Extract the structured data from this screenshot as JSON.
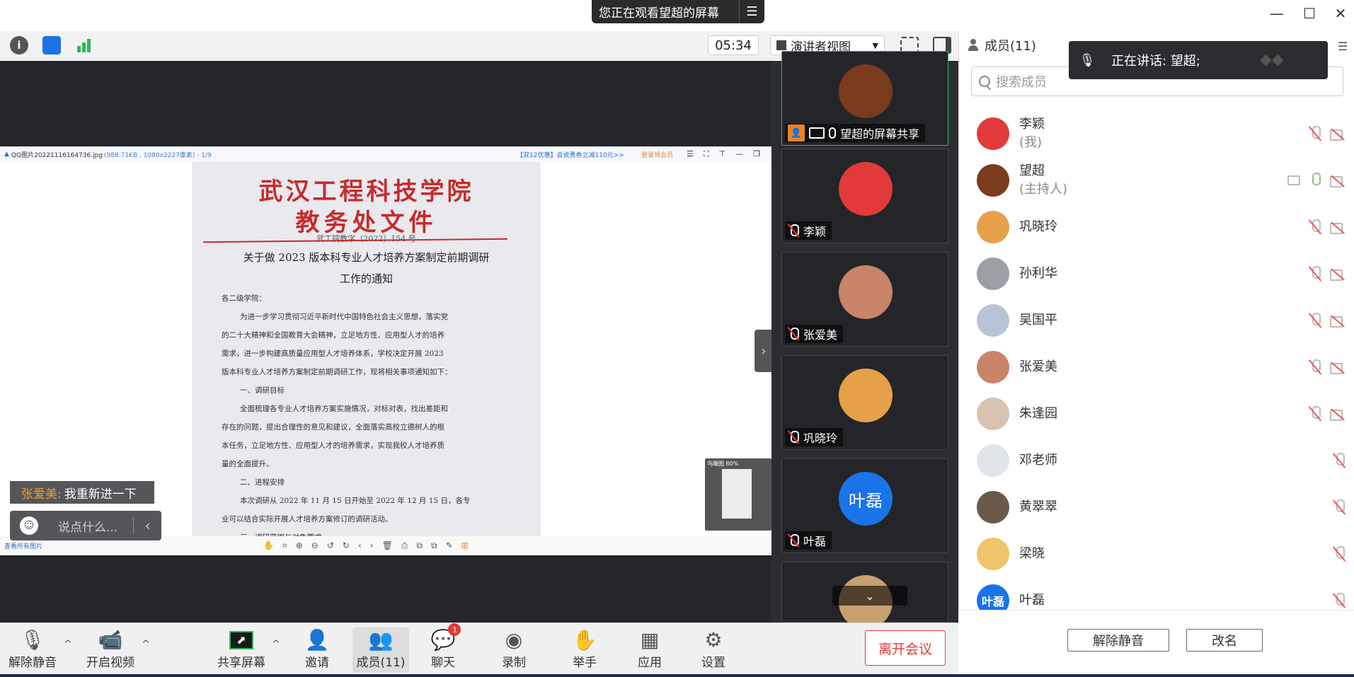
{
  "titlebar": {
    "watching_notice": "您正在观看望超的屏幕",
    "menu_glyph": "☰",
    "minimize": "—",
    "maximize": "☐",
    "close": "✕"
  },
  "toolbar": {
    "info_glyph": "i",
    "timer": "05:34",
    "view_mode": "演讲者视图",
    "view_caret": "▼"
  },
  "shared_window": {
    "filename": "QQ图片20221116164736.jpg",
    "meta": "(988.71KB , 1080x2227像素) - 1/9",
    "ad_text": "【双12优惠】会说勇券立减110元>>",
    "login_text": "登录领会员",
    "window_controls": [
      "☰",
      "⛶",
      "⊤",
      "—",
      "❐",
      "✕"
    ],
    "bottom_link": "查看所有图片",
    "mini_preview_label": "鸟瞰图 80%",
    "document": {
      "header_line1": "武汉工程科技学院",
      "header_line2": "教务处文件",
      "doc_number": "武工院教字〔2022〕154 号",
      "title_line1": "关于做 2023 版本科专业人才培养方案制定前期调研",
      "title_line2": "工作的通知",
      "paragraphs": [
        "各二级学院：",
        "为进一步学习贯彻习近平新时代中国特色社会主义思想，落实党",
        "的二十大精神和全国教育大会精神，立足地方性、应用型人才的培养",
        "需求，进一步构建高质量应用型人才培养体系，学校决定开展 2023",
        "版本科专业人才培养方案制定前期调研工作，现将相关事项通知如下：",
        "一、调研目标",
        "全面梳理各专业人才培养方案实施情况，对标对表，找出差距和",
        "存在的问题，提出合理性的意见和建议，全面落实高校立德树人的根",
        "本任务，立足地方性、应用型人才的培养需求，实现我校人才培养质",
        "量的全面提升。",
        "二、进程安排",
        "本次调研从 2022 年 11 月 15 日开始至 2022 年 12 月 15 日，各专",
        "业可以结合实际开展人才培养方案修订的调研活动。",
        "三、调研范围与对象要求"
      ]
    },
    "bottom_tools": [
      "✋",
      "⌗",
      "⊕",
      "⊖",
      "↺",
      "↻",
      "‹",
      "›",
      "🗑",
      "⎙",
      "⧉",
      "⧉",
      "✎",
      "⊞"
    ]
  },
  "collapse_glyph": "›",
  "chat": {
    "sender": "张爱美:",
    "message": "我重新进一下",
    "input_placeholder": "说点什么...",
    "emoji_glyph": "☺",
    "arrow_glyph": "‹"
  },
  "video_tiles": [
    {
      "name": "望超的屏幕共享",
      "color": "#7a3b1e",
      "host_glyph": "👤"
    },
    {
      "name": "李颖",
      "color": "#e23a3a"
    },
    {
      "name": "张爱美",
      "color": "#c9846a"
    },
    {
      "name": "巩晓玲",
      "color": "#e6a04a"
    },
    {
      "name": "叶磊",
      "color": "#1a73e8",
      "initials": "叶磊"
    }
  ],
  "strip_down_glyph": "⌄",
  "speaking": {
    "text": "正在讲话: 望超;",
    "mic_glyph": "🎙",
    "logo_glyph": "◆◆"
  },
  "panel": {
    "title": "成员(11)",
    "menu_glyph": "☰",
    "search_placeholder": "搜索成员",
    "members": [
      {
        "name": "李颖",
        "role": "(我)",
        "color": "#e23a3a",
        "icons": [
          "mic-off",
          "cam-off"
        ]
      },
      {
        "name": "望超",
        "role": "(主持人)",
        "color": "#7a3b1e",
        "icons": [
          "screen",
          "mic-on",
          "cam-off"
        ]
      },
      {
        "name": "巩晓玲",
        "role": "",
        "color": "#e6a04a",
        "icons": [
          "mic-off",
          "cam-off"
        ]
      },
      {
        "name": "孙利华",
        "role": "",
        "color": "#9aa0a6",
        "icons": [
          "mic-off",
          "cam-off"
        ]
      },
      {
        "name": "吴国平",
        "role": "",
        "color": "#b8c4d4",
        "icons": [
          "mic-off",
          "cam-off"
        ]
      },
      {
        "name": "张爱美",
        "role": "",
        "color": "#c9846a",
        "icons": [
          "mic-off",
          "cam-off"
        ]
      },
      {
        "name": "朱逢园",
        "role": "",
        "color": "#d8c3b0",
        "icons": [
          "mic-off",
          "cam-off"
        ]
      },
      {
        "name": "邓老师",
        "role": "",
        "color": "#dfe6ea",
        "icons": [
          "mic-off"
        ]
      },
      {
        "name": "黄翠翠",
        "role": "",
        "color": "#6a5a4a",
        "icons": [
          "mic-off"
        ]
      },
      {
        "name": "梁晓",
        "role": "",
        "color": "#efc46a",
        "icons": [
          "mic-off"
        ]
      },
      {
        "name": "叶磊",
        "role": "",
        "color": "#1a73e8",
        "initials": "叶磊",
        "icons": [
          "mic-off"
        ]
      }
    ],
    "unmute_all": "解除静音",
    "rename": "改名"
  },
  "bottom_bar": {
    "unmute": "解除静音",
    "start_video": "开启视频",
    "share_screen": "共享屏幕",
    "invite": "邀请",
    "members": "成员(11)",
    "chat": "聊天",
    "chat_badge": "1",
    "record": "录制",
    "raise_hand": "举手",
    "apps": "应用",
    "settings": "设置",
    "leave": "离开会议",
    "caret": "^",
    "glyphs": {
      "unmute": "🎙",
      "video": "📹",
      "share": "⬈",
      "invite": "👤",
      "members": "👥",
      "chat": "💬",
      "record": "◉",
      "hand": "✋",
      "apps": "▦",
      "settings": "⚙"
    }
  }
}
